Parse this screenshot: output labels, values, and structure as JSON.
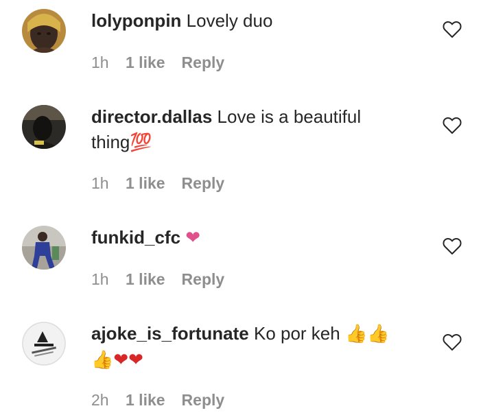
{
  "comments": [
    {
      "username": "lolyponpin",
      "text": "Lovely duo",
      "time": "1h",
      "likes": "1 like",
      "reply": "Reply"
    },
    {
      "username": "director.dallas",
      "text": "Love is a beautiful",
      "text2": "thing",
      "emoji": "💯",
      "time": "1h",
      "likes": "1 like",
      "reply": "Reply"
    },
    {
      "username": "funkid_cfc",
      "emoji": "❤",
      "time": "1h",
      "likes": "1 like",
      "reply": "Reply"
    },
    {
      "username": "ajoke_is_fortunate",
      "text": "Ko por keh",
      "emoji": "👍👍",
      "emoji2": "👍❤❤",
      "time": "2h",
      "likes": "1 like",
      "reply": "Reply"
    }
  ],
  "icons": {
    "like": "heart-outline-icon"
  },
  "colors": {
    "meta": "#8e8e8e",
    "text": "#262626",
    "pink_heart": "#e0508a",
    "red_heart": "#d92626",
    "thumbs": "#f5b72b",
    "hundred": "#e0452b"
  }
}
